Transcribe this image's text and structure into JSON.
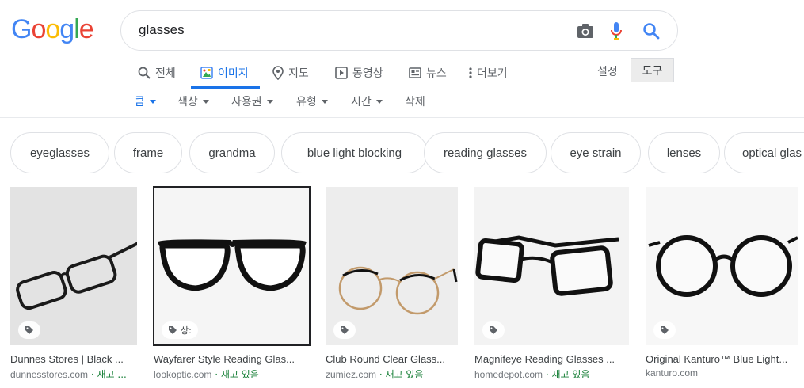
{
  "logo": {
    "text": "Google",
    "letters": [
      {
        "ch": "G",
        "color": "#4285F4"
      },
      {
        "ch": "o",
        "color": "#EA4335"
      },
      {
        "ch": "o",
        "color": "#FBBC05"
      },
      {
        "ch": "g",
        "color": "#4285F4"
      },
      {
        "ch": "l",
        "color": "#34A853"
      },
      {
        "ch": "e",
        "color": "#EA4335"
      }
    ]
  },
  "search": {
    "query": "glasses"
  },
  "tabs": [
    {
      "label": "전체",
      "icon": "search-icon"
    },
    {
      "label": "이미지",
      "icon": "image-icon",
      "active": true
    },
    {
      "label": "지도",
      "icon": "map-pin-icon"
    },
    {
      "label": "동영상",
      "icon": "video-icon"
    },
    {
      "label": "뉴스",
      "icon": "news-icon"
    },
    {
      "label": "더보기",
      "icon": "more-vert-icon"
    }
  ],
  "settings_label": "설정",
  "tools_label": "도구",
  "filters": [
    "큼",
    "색상",
    "사용권",
    "유형",
    "시간",
    "삭제"
  ],
  "chips": [
    "eyeglasses",
    "frame",
    "grandma",
    "blue light blocking",
    "reading glasses",
    "eye strain",
    "lenses",
    "optical glas"
  ],
  "results": [
    {
      "title": "Dunnes Stores | Black ...",
      "source": "dunnesstores.com",
      "stock": " · 재고 ..."
    },
    {
      "title": "Wayfarer Style Reading Glas...",
      "source": "lookoptic.com",
      "stock": " · 재고 있음",
      "badge_text": "상:"
    },
    {
      "title": "Club Round Clear Glass...",
      "source": "zumiez.com",
      "stock": " · 재고 있음"
    },
    {
      "title": "Magnifeye Reading Glasses ...",
      "source": "homedepot.com",
      "stock": " · 재고 있음"
    },
    {
      "title": "Original Kanturo™ Blue Light...",
      "source": "kanturo.com",
      "stock": ""
    }
  ],
  "colors": {
    "accent": "#1a73e8",
    "in_stock": "#188038",
    "chip_border": "#dfe1e5"
  }
}
